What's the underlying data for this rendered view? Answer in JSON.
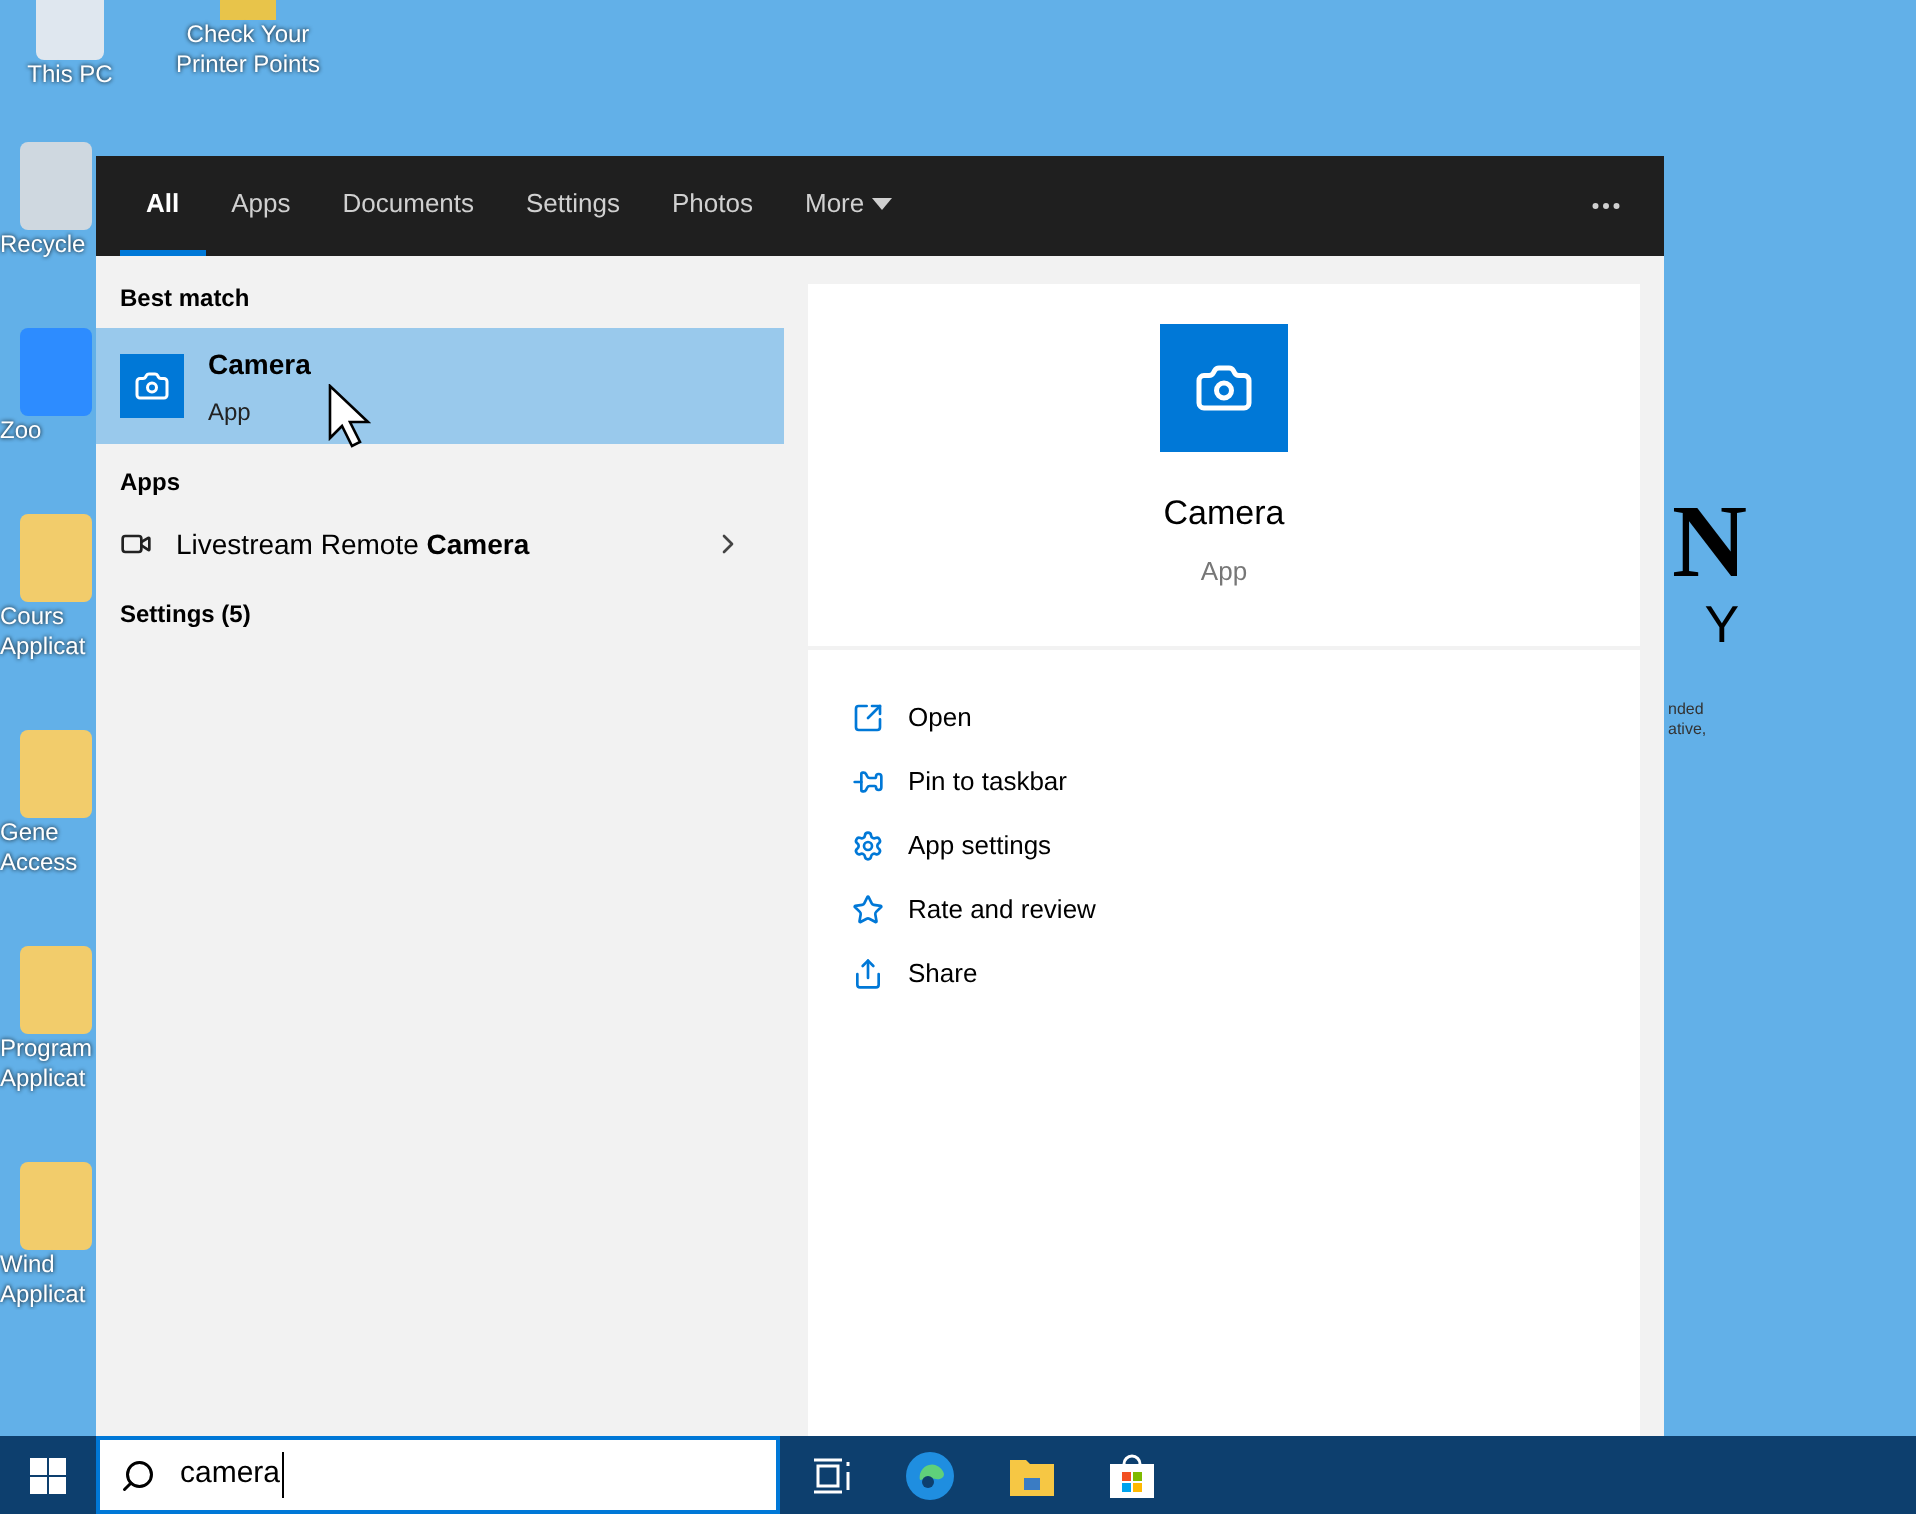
{
  "desktop": {
    "icons": [
      {
        "label": "This PC"
      },
      {
        "label": "Check Your Printer Points"
      },
      {
        "label": "Recycle"
      },
      {
        "label": "Zoo"
      },
      {
        "label": "Cours Applicat"
      },
      {
        "label": "Gene Access"
      },
      {
        "label": "Program Applicat"
      },
      {
        "label": "Wind Applicat"
      }
    ],
    "wallpaper_texts": [
      "N",
      "Y",
      "nded",
      "ative,"
    ]
  },
  "search_panel": {
    "tabs": [
      {
        "label": "All",
        "selected": true
      },
      {
        "label": "Apps",
        "selected": false
      },
      {
        "label": "Documents",
        "selected": false
      },
      {
        "label": "Settings",
        "selected": false
      },
      {
        "label": "Photos",
        "selected": false
      },
      {
        "label": "More",
        "selected": false
      }
    ],
    "best_match_heading": "Best match",
    "best_match": {
      "title": "Camera",
      "subtitle": "App",
      "selected": true
    },
    "apps_heading": "Apps",
    "apps": [
      {
        "name": "Livestream Remote **Camera**"
      }
    ],
    "settings_heading": "Settings (5)",
    "preview": {
      "title": "Camera",
      "subtitle": "App",
      "actions": [
        {
          "kind": "open",
          "label": "Open"
        },
        {
          "kind": "pin",
          "label": "Pin to taskbar"
        },
        {
          "kind": "settings",
          "label": "App settings"
        },
        {
          "kind": "rate",
          "label": "Rate and review"
        },
        {
          "kind": "share",
          "label": "Share"
        }
      ]
    }
  },
  "taskbar": {
    "search_value": "camera"
  }
}
